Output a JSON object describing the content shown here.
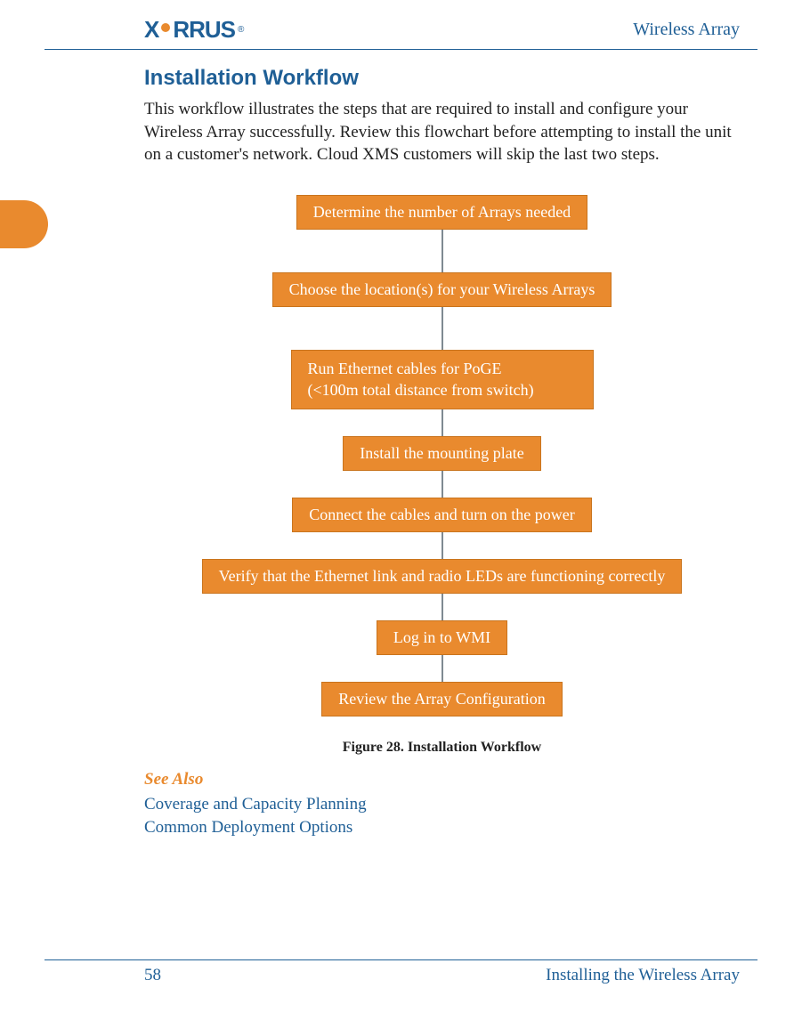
{
  "header": {
    "logo_prefix": "X",
    "logo_suffix": "RRUS",
    "logo_reg": "®",
    "doc_title": "Wireless Array"
  },
  "section": {
    "title": "Installation Workflow",
    "intro": "This workflow illustrates the steps that are required to install and configure your Wireless Array successfully. Review this flowchart before attempting to install the unit on a customer's network. Cloud XMS customers will skip the last two steps."
  },
  "chart_data": {
    "type": "table",
    "title": "Figure 28. Installation Workflow",
    "steps": [
      "Determine the number of Arrays needed",
      "Choose the location(s) for your Wireless Arrays",
      "Run Ethernet cables for PoGE\n(<100m total distance from switch)",
      "Install the mounting plate",
      "Connect the cables and turn on the power",
      "Verify that the Ethernet link and radio LEDs are functioning correctly",
      "Log in to WMI",
      "Review the Array Configuration"
    ]
  },
  "see_also": {
    "heading": "See Also",
    "links": [
      "Coverage and Capacity Planning",
      "Common Deployment Options"
    ]
  },
  "footer": {
    "page": "58",
    "chapter": "Installing the Wireless Array"
  }
}
